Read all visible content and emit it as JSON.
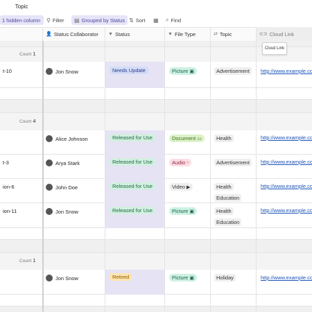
{
  "tabs": {
    "topic": "Topic"
  },
  "toolbar": {
    "hidden": "1 hidden column",
    "filter": "Filter",
    "grouped": "Grouped by Status",
    "sort": "Sort",
    "find": "Find"
  },
  "columns": {
    "collaborator": "Status Collaborator",
    "status": "Status",
    "file_type": "File Type",
    "topic": "Topic",
    "cloud_link": "Cloud Link"
  },
  "tooltip": "Cloud Link",
  "groups": [
    {
      "count_label": "Count",
      "count": "1"
    },
    {
      "count_label": "Count",
      "count": "4"
    },
    {
      "count_label": "Count",
      "count": "1"
    }
  ],
  "rows": [
    {
      "name": "t-10",
      "person": "Jon Snow",
      "status": "Needs Update",
      "file_type": "Picture",
      "topics": [
        "Advertisement"
      ],
      "link": "http://www.example.co"
    },
    {
      "name": "",
      "person": "Alice Johnson",
      "status": "Released for Use",
      "file_type": "Document",
      "topics": [
        "Health"
      ],
      "link": "http://www.example.co"
    },
    {
      "name": "t-3",
      "person": "Arya Stark",
      "status": "Released for Use",
      "file_type": "Audio",
      "topics": [
        "Advertisement"
      ],
      "link": "http://www.example.co"
    },
    {
      "name": "ion-6",
      "person": "John Doe",
      "status": "Released for Use",
      "file_type": "Video",
      "topics": [
        "Health",
        "Education"
      ],
      "link": "http://www.example.co"
    },
    {
      "name": "ion-11",
      "person": "Jon Snow",
      "status": "Released for Use",
      "file_type": "Picture",
      "topics": [
        "Health",
        "Education"
      ],
      "link": "http://www.example.co"
    },
    {
      "name": "",
      "person": "Jon Snow",
      "status": "Retired",
      "file_type": "Picture",
      "topics": [
        "Holiday"
      ],
      "link": "http://www.example.co"
    }
  ],
  "icons": {
    "filter": "filter-icon",
    "grouped": "group-icon",
    "sort": "sort-icon",
    "fields": "fields-icon",
    "find": "search-icon",
    "person": "person-icon",
    "status": "status-icon",
    "file_type": "file-type-icon",
    "topic": "topic-icon",
    "link": "link-icon"
  }
}
